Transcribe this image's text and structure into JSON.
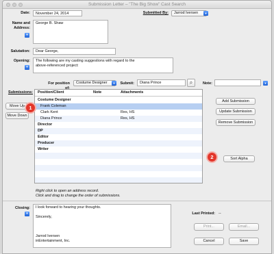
{
  "window": {
    "title": "Submission Letter – \"The Big Show\" Cast Search"
  },
  "form": {
    "date_label": "Date:",
    "date_value": "November 24, 2014",
    "submitted_by_label": "Submitted By:",
    "submitted_by_value": "Jarrod Iversen",
    "name_address_label_1": "Name and",
    "name_address_label_2": "Address:",
    "name_address_value": "George B. Shaw",
    "salutation_label": "Salutation:",
    "salutation_value": "Dear George,",
    "opening_label": "Opening:",
    "opening_value": "The following are my casting suggestions with regard to the\nabove-referenced project:",
    "for_position_label": "For position of:",
    "for_position_value": "Costume Designer",
    "submit_label": "Submit:",
    "submit_value": "Diana Prince",
    "note_label": "Note:",
    "note_value": ""
  },
  "submissions": {
    "label": "Submissions:",
    "columns": [
      "Position/Client",
      "Note",
      "Attachments"
    ],
    "rows": [
      {
        "kind": "group",
        "client": "Costume Designer",
        "note": "",
        "attachments": ""
      },
      {
        "kind": "item",
        "client": "Frank Coleman",
        "note": "",
        "attachments": "",
        "selected": true
      },
      {
        "kind": "item",
        "client": "Clark Kent",
        "note": "",
        "attachments": "Res, HS"
      },
      {
        "kind": "item",
        "client": "Diana Prince",
        "note": "",
        "attachments": "Res, HS"
      },
      {
        "kind": "group",
        "client": "Director",
        "note": "",
        "attachments": ""
      },
      {
        "kind": "group",
        "client": "DP",
        "note": "",
        "attachments": ""
      },
      {
        "kind": "group",
        "client": "Editor",
        "note": "",
        "attachments": ""
      },
      {
        "kind": "group",
        "client": "Producer",
        "note": "",
        "attachments": ""
      },
      {
        "kind": "group",
        "client": "Writer",
        "note": "",
        "attachments": ""
      }
    ],
    "hint_1": "Right click to open an address record.",
    "hint_2": "Click and drag to change the order of submissions."
  },
  "buttons": {
    "move_up": "Move Up",
    "move_down": "Move Down",
    "add_submission": "Add Submission",
    "update_submission": "Update Submission",
    "remove_submission": "Remove Submission",
    "sort_alpha": "Sort Alpha",
    "print": "Print...",
    "email": "Email...",
    "cancel": "Cancel",
    "save": "Save"
  },
  "closing": {
    "label": "Closing:",
    "value": "I look forward to hearing your thoughts.\n\nSincerely,\n\n\n\nJarrod Iversen\ninEntertainment, Inc."
  },
  "last_printed": {
    "label": "Last Printed:",
    "value": "--"
  },
  "callouts": {
    "one": "1",
    "two": "2"
  },
  "icons": {
    "lookup": "search-icon",
    "arrow": "chevron-down-icon"
  },
  "colors": {
    "selection": "#b7cff2",
    "callout": "#e3362b",
    "accent": "#1f62d6"
  }
}
